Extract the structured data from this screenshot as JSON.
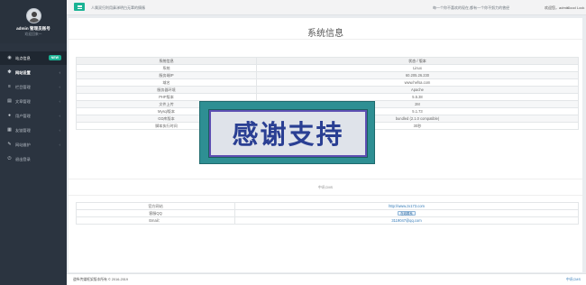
{
  "profile": {
    "username": "admin",
    "role": "管理员账号",
    "subtitle": "欢迎回来一"
  },
  "sidebar": {
    "items": [
      {
        "icon": "wifi-icon",
        "label": "站点信息",
        "badge": "NEW",
        "active": true
      },
      {
        "icon": "gear-icon",
        "label": "网站设置",
        "open": true
      },
      {
        "icon": "bars-icon",
        "label": "栏目管理"
      },
      {
        "icon": "file-icon",
        "label": "文章管理"
      },
      {
        "icon": "user-icon",
        "label": "用户管理"
      },
      {
        "icon": "table-icon",
        "label": "友链管理"
      },
      {
        "icon": "wrench-icon",
        "label": "网站维护"
      },
      {
        "icon": "power-icon",
        "label": "退出登录"
      }
    ]
  },
  "topbar": {
    "left_text": "人属双归利用鼻涕明白无辜的情愫",
    "right_text": "每一个你不喜欢的现在,都有一个你不努力的曾经",
    "welcome": "欢迎您，admin",
    "lock_label": "Good Lock"
  },
  "page": {
    "title": "系统信息"
  },
  "system_table": {
    "headers": [
      "系统信息",
      "状态 / 版本"
    ],
    "rows": [
      [
        "系统",
        "Linux"
      ],
      [
        "服务端IP",
        "60.205.26.230"
      ],
      [
        "域名",
        "www.hefsa.com"
      ],
      [
        "服务器环境",
        "Apache"
      ],
      [
        "PHP版本",
        "5.5.38"
      ],
      [
        "文件上传",
        "2M"
      ],
      [
        "Mysql版本",
        "5.1.73"
      ],
      [
        "GD库版本",
        "bundled (2.1.0 compatible)"
      ],
      [
        "脚本执行时间",
        "30秒"
      ]
    ]
  },
  "cms_label": "中讯CMS",
  "info_table": {
    "rows": [
      {
        "label": "官方网站",
        "value": "http://www.zx173.com",
        "type": "link"
      },
      {
        "label": "客服QQ",
        "value": "在线联系",
        "type": "button"
      },
      {
        "label": "Email：",
        "value": "3119047@qq.com",
        "type": "link"
      }
    ]
  },
  "banner": {
    "text": "感谢支持"
  },
  "footer": {
    "left": "道纵传媒框架版本所有 © 2016-2019",
    "right": "中讯CMS"
  },
  "colors": {
    "accent": "#1ab394",
    "sidebar": "#2b3440",
    "link": "#337ab7"
  }
}
